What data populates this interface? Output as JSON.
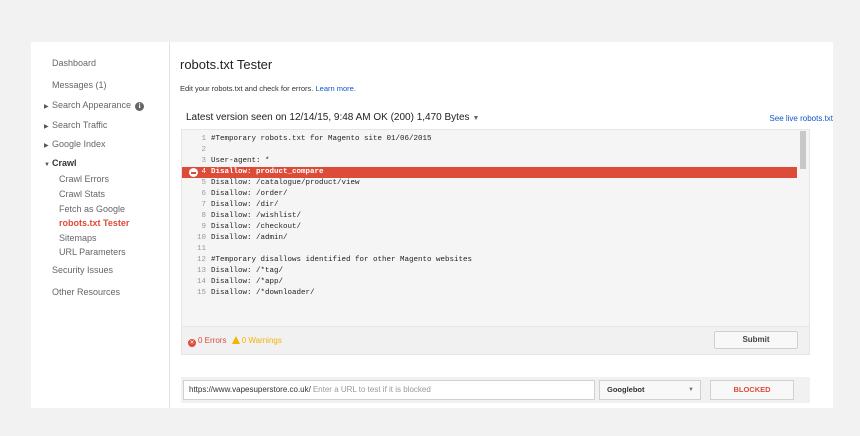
{
  "sidebar": {
    "items": [
      {
        "label": "Dashboard"
      },
      {
        "label": "Messages (1)"
      },
      {
        "label": "Search Appearance"
      },
      {
        "label": "Search Traffic"
      },
      {
        "label": "Google Index"
      },
      {
        "label": "Crawl"
      },
      {
        "label": "Crawl Errors"
      },
      {
        "label": "Crawl Stats"
      },
      {
        "label": "Fetch as Google"
      },
      {
        "label": "robots.txt Tester"
      },
      {
        "label": "Sitemaps"
      },
      {
        "label": "URL Parameters"
      },
      {
        "label": "Security Issues"
      },
      {
        "label": "Other Resources"
      }
    ],
    "active_color": "#dd4b39"
  },
  "main": {
    "title": "robots.txt Tester",
    "description": "Edit your robots.txt and check for errors.",
    "learn_more": "Learn more.",
    "version_text": "Latest version seen on 12/14/15, 9:48 AM OK (200) 1,470 Bytes",
    "see_live": "See live robots.txt"
  },
  "editor": {
    "lines": [
      {
        "num": "1",
        "text": "#Temporary robots.txt for Magento site 01/06/2015"
      },
      {
        "num": "2",
        "text": ""
      },
      {
        "num": "3",
        "text": "User-agent: *"
      },
      {
        "num": "4",
        "text": "Disallow: product_compare",
        "error": true
      },
      {
        "num": "5",
        "text": "Disallow: /catalogue/product/view"
      },
      {
        "num": "6",
        "text": "Disallow: /order/"
      },
      {
        "num": "7",
        "text": "Disallow: /dir/"
      },
      {
        "num": "8",
        "text": "Disallow: /wishlist/"
      },
      {
        "num": "9",
        "text": "Disallow: /checkout/"
      },
      {
        "num": "10",
        "text": "Disallow: /admin/"
      },
      {
        "num": "11",
        "text": ""
      },
      {
        "num": "12",
        "text": "#Temporary disallows identified for other Magento websites"
      },
      {
        "num": "13",
        "text": "Disallow: /*tag/"
      },
      {
        "num": "14",
        "text": "Disallow: /*app/"
      },
      {
        "num": "15",
        "text": "Disallow: /*downloader/"
      }
    ],
    "error_color": "#dd4b39"
  },
  "status": {
    "errors": "0 Errors",
    "warnings": "0 Warnings",
    "submit": "Submit",
    "warning_color": "#f4b400"
  },
  "tester": {
    "url_prefix": "https://www.vapesuperstore.co.uk/",
    "url_placeholder": "Enter a URL to test if it is blocked",
    "agent": "Googlebot",
    "result": "BLOCKED"
  }
}
